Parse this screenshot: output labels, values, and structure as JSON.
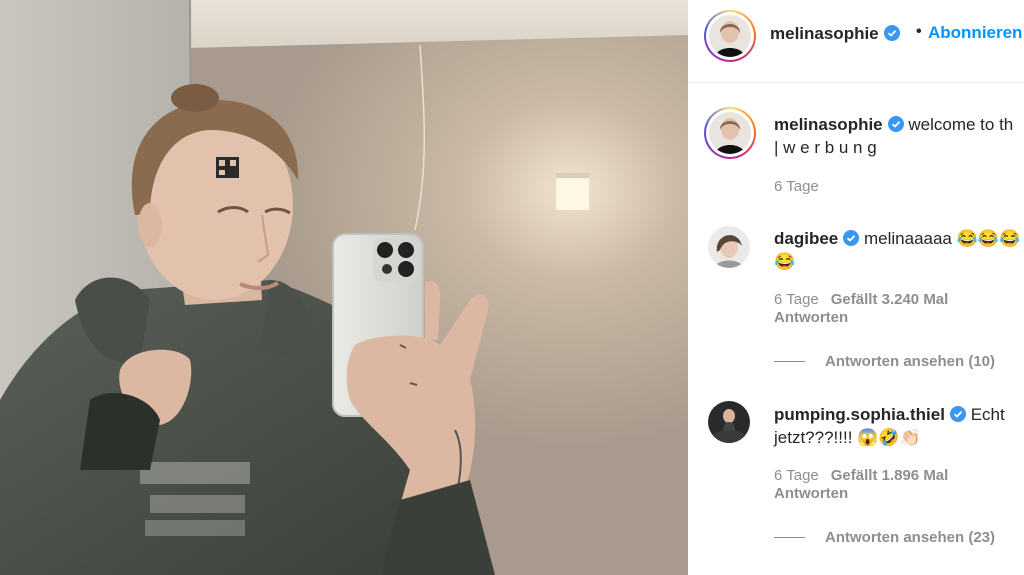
{
  "post": {
    "author": "melinasophie",
    "follow_label": "Abonnieren",
    "separator": "•",
    "caption": {
      "username": "melinasophie",
      "text_line1": "welcome to th",
      "text_line2": "| w e r b u n g",
      "time": "6 Tage"
    }
  },
  "comments": [
    {
      "username": "dagibee",
      "text_line1": "melinaaaaa 😂😂😂",
      "text_line2": "😂",
      "time": "6 Tage",
      "likes": "Gefällt 3.240 Mal",
      "reply": "Antworten",
      "view_replies": "Antworten ansehen (10)"
    },
    {
      "username": "pumping.sophia.thiel",
      "text_line1": "Echt",
      "text_line2": "jetzt???!!!! 😱🤣👏🏻",
      "time": "6 Tage",
      "likes": "Gefällt 1.896 Mal",
      "reply": "Antworten",
      "view_replies": "Antworten ansehen (23)"
    }
  ],
  "colors": {
    "link": "#0095f6",
    "verified": "#3897f0",
    "muted": "#8e8e8e",
    "text": "#262626"
  },
  "icons": {
    "verified": "verified-badge-icon"
  }
}
